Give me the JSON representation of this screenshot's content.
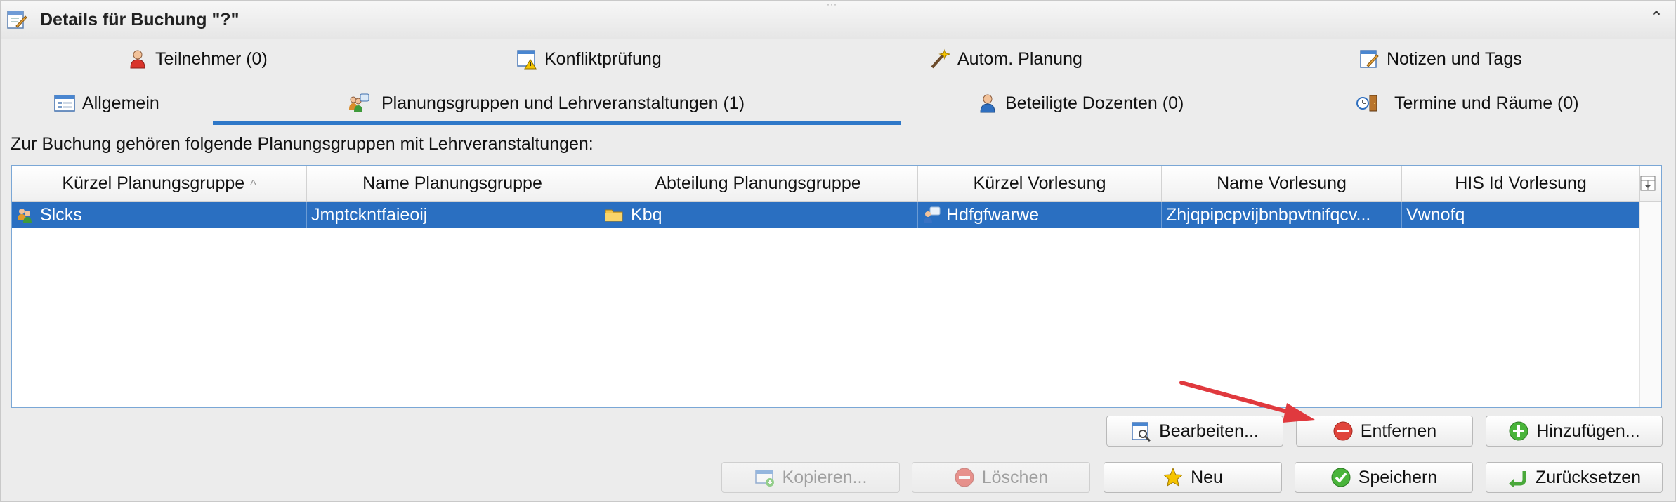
{
  "window": {
    "title": "Details für Buchung \"?\"",
    "collapse_icon": "chevron-up-icon"
  },
  "tabs": {
    "row1": [
      {
        "label": "Teilnehmer (0)",
        "icon": "person-icon"
      },
      {
        "label": "Konfliktprüfung",
        "icon": "warning-window-icon"
      },
      {
        "label": "Autom. Planung",
        "icon": "magic-wand-icon"
      },
      {
        "label": "Notizen und Tags",
        "icon": "note-edit-icon"
      }
    ],
    "row2": [
      {
        "label": "Allgemein",
        "icon": "form-icon"
      },
      {
        "label": "Planungsgruppen und Lehrveranstaltungen (1)",
        "icon": "group-lecture-icon",
        "selected": true
      },
      {
        "label": "Beteiligte Dozenten (0)",
        "icon": "lecturer-icon"
      },
      {
        "label": "Termine und Räume (0)",
        "icon": "clock-door-icon"
      }
    ]
  },
  "description": "Zur Buchung gehören folgende Planungsgruppen mit Lehrveranstaltungen:",
  "table": {
    "columns": [
      "Kürzel Planungsgruppe",
      "Name Planungsgruppe",
      "Abteilung Planungsgruppe",
      "Kürzel Vorlesung",
      "Name Vorlesung",
      "HIS Id Vorlesung"
    ],
    "sort_indicator": "^",
    "rows": [
      {
        "kuerzel_gruppe": "Slcks",
        "name_gruppe": "Jmptckntfaieoij",
        "abteilung": "Kbq",
        "kuerzel_vorlesung": "Hdfgfwarwe",
        "name_vorlesung": "Zhjqpipcpvijbnbpvtnifqcv...",
        "his_id": "Vwnofq"
      }
    ]
  },
  "buttons": {
    "bearbeiten": "Bearbeiten...",
    "entfernen": "Entfernen",
    "hinzufuegen": "Hinzufügen...",
    "kopieren": "Kopieren...",
    "loeschen": "Löschen",
    "neu": "Neu",
    "speichern": "Speichern",
    "zuruecksetzen": "Zurücksetzen"
  },
  "colors": {
    "selection": "#2a6fc1",
    "tab_underline": "#2f78c8",
    "annotation_arrow": "#e0393e"
  }
}
